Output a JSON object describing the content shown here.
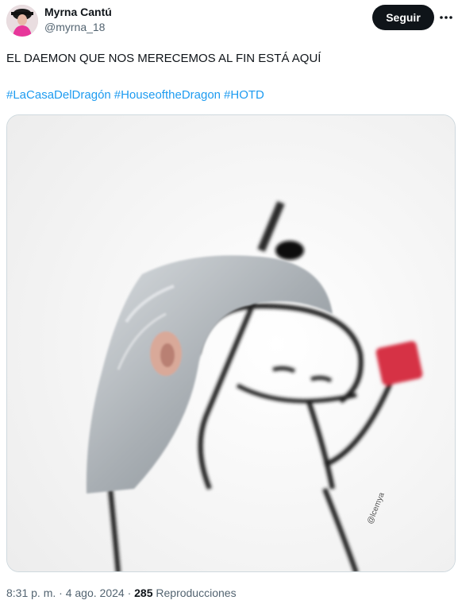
{
  "author": {
    "display_name": "Myrna Cantú",
    "handle": "@myrna_18",
    "avatar_icon": "avatar-photo"
  },
  "actions": {
    "follow_label": "Seguir",
    "more_icon": "more-icon"
  },
  "tweet": {
    "text": "EL DAEMON QUE NOS MERECEMOS AL FIN ESTÁ AQUÍ",
    "hashtags": [
      "#LaCasaDelDragón",
      "#HouseoftheDragon",
      "#HOTD"
    ]
  },
  "media": {
    "watermark": "@lcemya"
  },
  "meta": {
    "time": "8:31 p. m.",
    "separator": "·",
    "date": "4 ago. 2024",
    "views_count": "285",
    "views_label": "Reproducciones"
  },
  "colors": {
    "accent": "#1d9bf0",
    "text": "#0f1419",
    "muted": "#536471"
  }
}
